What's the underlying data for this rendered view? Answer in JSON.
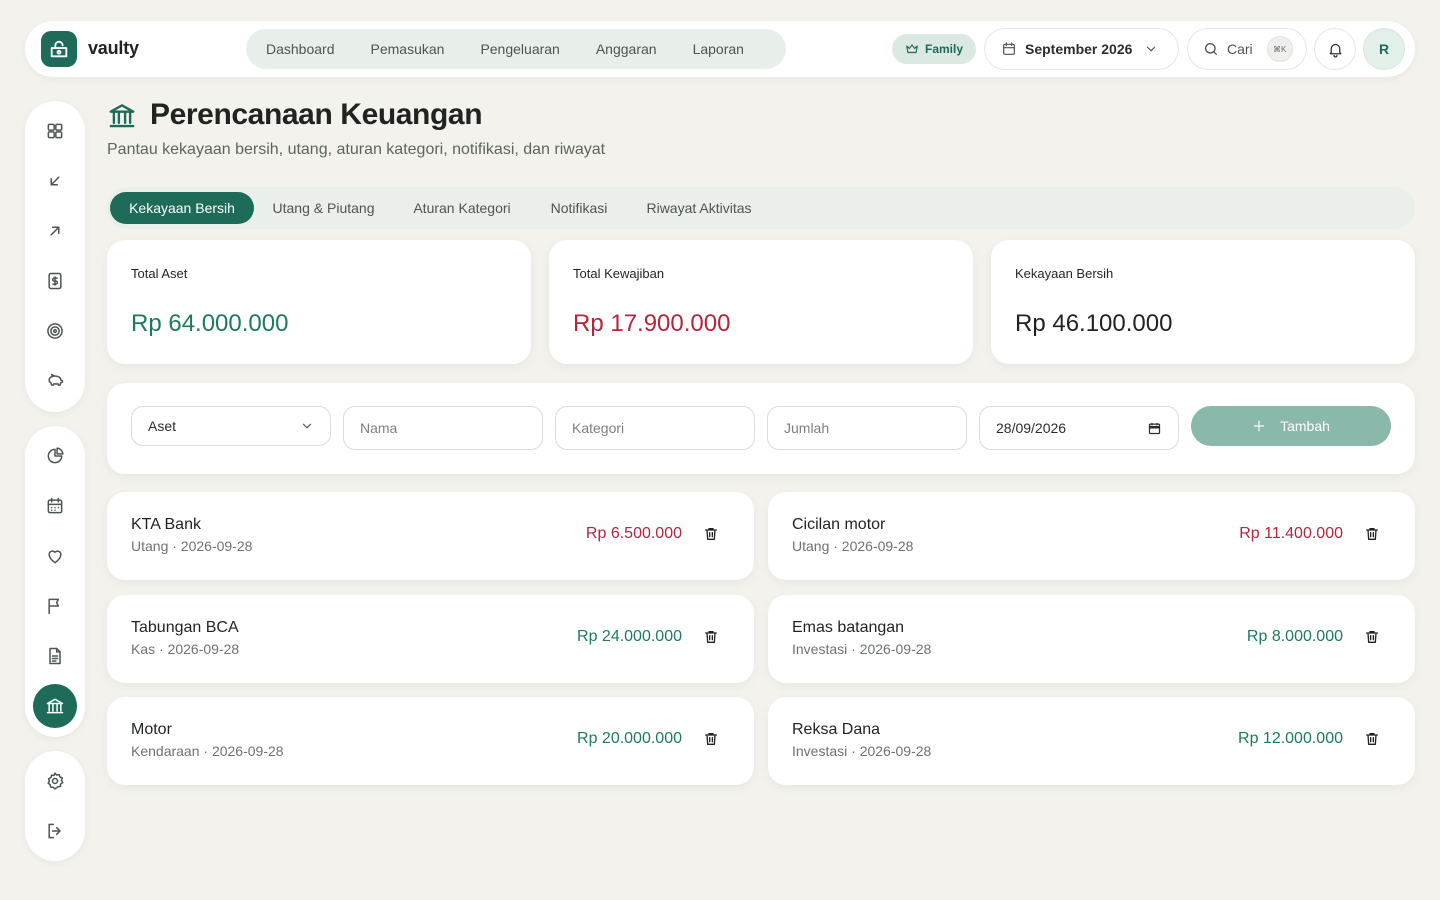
{
  "app": {
    "brand": "vaulty"
  },
  "nav": [
    "Dashboard",
    "Pemasukan",
    "Pengeluaran",
    "Anggaran",
    "Laporan"
  ],
  "header": {
    "plan_badge": "Family",
    "month": "September 2026",
    "search_label": "Cari",
    "search_shortcut": "⌘K",
    "avatar_initial": "R"
  },
  "page": {
    "title": "Perencanaan Keuangan",
    "subtitle": "Pantau kekayaan bersih, utang, aturan kategori, notifikasi, dan riwayat"
  },
  "tabs": [
    "Kekayaan Bersih",
    "Utang & Piutang",
    "Aturan Kategori",
    "Notifikasi",
    "Riwayat Aktivitas"
  ],
  "active_tab": "Kekayaan Bersih",
  "summary": {
    "assets": {
      "label": "Total Aset",
      "value": "Rp 64.000.000"
    },
    "liabilities": {
      "label": "Total Kewajiban",
      "value": "Rp 17.900.000"
    },
    "net_worth": {
      "label": "Kekayaan Bersih",
      "value": "Rp 46.100.000"
    }
  },
  "form": {
    "type_value": "Aset",
    "name_placeholder": "Nama",
    "category_placeholder": "Kategori",
    "amount_placeholder": "Jumlah",
    "date_value": "28/09/2026",
    "add_label": "Tambah"
  },
  "items": [
    {
      "name": "KTA Bank",
      "meta": "Utang · 2026-09-28",
      "amount": "Rp 6.500.000",
      "kind": "neg"
    },
    {
      "name": "Cicilan motor",
      "meta": "Utang · 2026-09-28",
      "amount": "Rp 11.400.000",
      "kind": "neg"
    },
    {
      "name": "Tabungan BCA",
      "meta": "Kas · 2026-09-28",
      "amount": "Rp 24.000.000",
      "kind": "pos"
    },
    {
      "name": "Emas batangan",
      "meta": "Investasi · 2026-09-28",
      "amount": "Rp 8.000.000",
      "kind": "pos"
    },
    {
      "name": "Motor",
      "meta": "Kendaraan · 2026-09-28",
      "amount": "Rp 20.000.000",
      "kind": "pos"
    },
    {
      "name": "Reksa Dana",
      "meta": "Investasi · 2026-09-28",
      "amount": "Rp 12.000.000",
      "kind": "pos"
    }
  ],
  "colors": {
    "brand": "#1d6b58",
    "positive": "#1d7a5f",
    "negative": "#b3263c",
    "background": "#f3f2ed"
  },
  "sidebar_icons": [
    "grid-icon",
    "arrow-down-left-icon",
    "arrow-up-right-icon",
    "dollar-note-icon",
    "target-icon",
    "piggy-bank-icon",
    "pie-chart-icon",
    "calendar-icon",
    "heart-icon",
    "flag-icon",
    "document-icon",
    "bank-icon",
    "gear-icon",
    "logout-icon"
  ]
}
